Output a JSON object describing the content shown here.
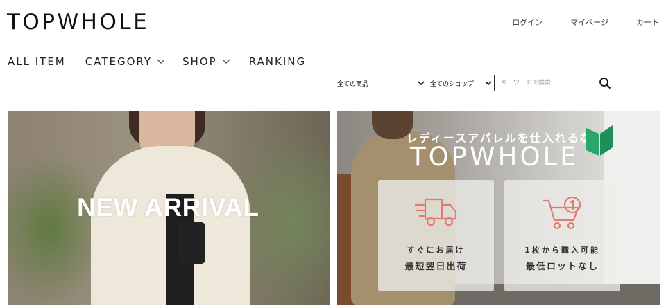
{
  "header": {
    "logo": "TOPWHOLE",
    "user_links": {
      "login": "ログイン",
      "mypage": "マイページ",
      "cart": "カート"
    }
  },
  "nav": {
    "all_item": "ALL ITEM",
    "category": "CATEGORY",
    "shop": "SHOP",
    "ranking": "RANKING"
  },
  "search": {
    "product_select": "全ての商品",
    "shop_select": "全てのショップ",
    "keyword_placeholder": "キーワードで検索",
    "keyword_value": ""
  },
  "banners": {
    "new_arrival": {
      "title": "NEW ARRIVAL"
    },
    "promo": {
      "subtitle": "レディースアパレルを仕入れるなら",
      "logo": "TOPWHOLE",
      "cards": [
        {
          "icon": "delivery-truck-icon",
          "line1": "すぐにお届け",
          "line2": "最短翌日出荷"
        },
        {
          "icon": "cart-one-icon",
          "line1": "1枚から購入可能",
          "line2": "最低ロットなし"
        }
      ]
    }
  },
  "colors": {
    "accent_icon": "#e07a72",
    "leaf_green": "#1f9a5f"
  }
}
